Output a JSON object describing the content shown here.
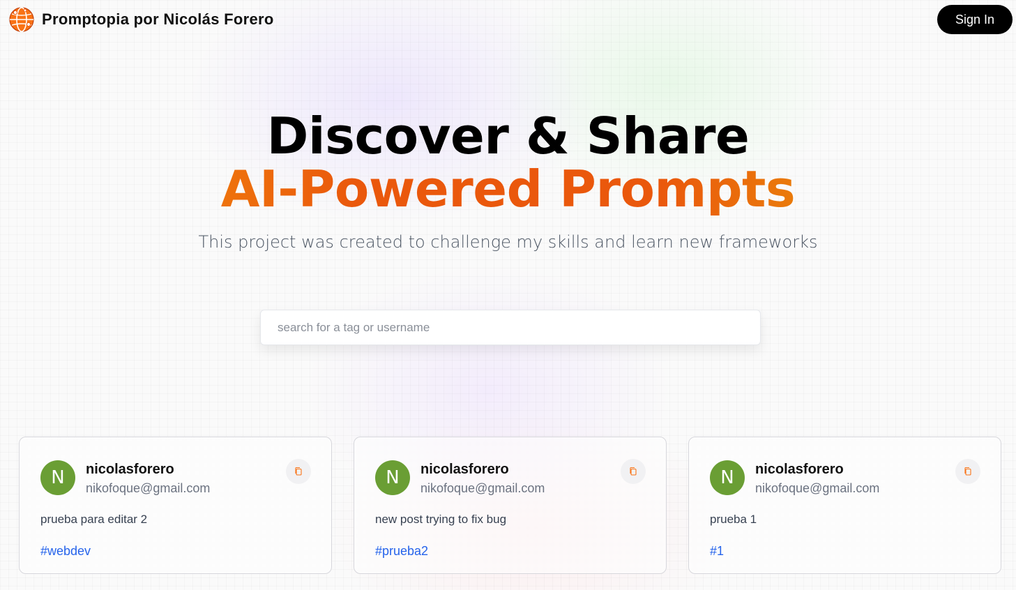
{
  "nav": {
    "brand": "Promptopia por Nicolás Forero",
    "sign_in": "Sign In",
    "logo_icon": "globe-network-icon",
    "accent": "#f97316"
  },
  "hero": {
    "title_line1": "Discover & Share",
    "title_line2": "AI-Powered Prompts",
    "subtitle": "This project was created to challenge my skills and learn new frameworks",
    "gradient_colors": [
      "#f59e0b",
      "#ea580c",
      "#eab308"
    ]
  },
  "search": {
    "placeholder": "search for a tag or username",
    "value": ""
  },
  "cards": [
    {
      "avatar_letter": "N",
      "username": "nicolasforero",
      "email": "nikofoque@gmail.com",
      "prompt": "prueba para editar 2",
      "tag": "#webdev",
      "copy_icon": "copy-icon"
    },
    {
      "avatar_letter": "N",
      "username": "nicolasforero",
      "email": "nikofoque@gmail.com",
      "prompt": "new post trying to fix bug",
      "tag": "#prueba2",
      "copy_icon": "copy-icon"
    },
    {
      "avatar_letter": "N",
      "username": "nicolasforero",
      "email": "nikofoque@gmail.com",
      "prompt": "prueba 1",
      "tag": "#1",
      "copy_icon": "copy-icon"
    }
  ],
  "colors": {
    "avatar_bg": "#6a9e34",
    "tag": "#2563eb",
    "button_bg": "#000000"
  }
}
